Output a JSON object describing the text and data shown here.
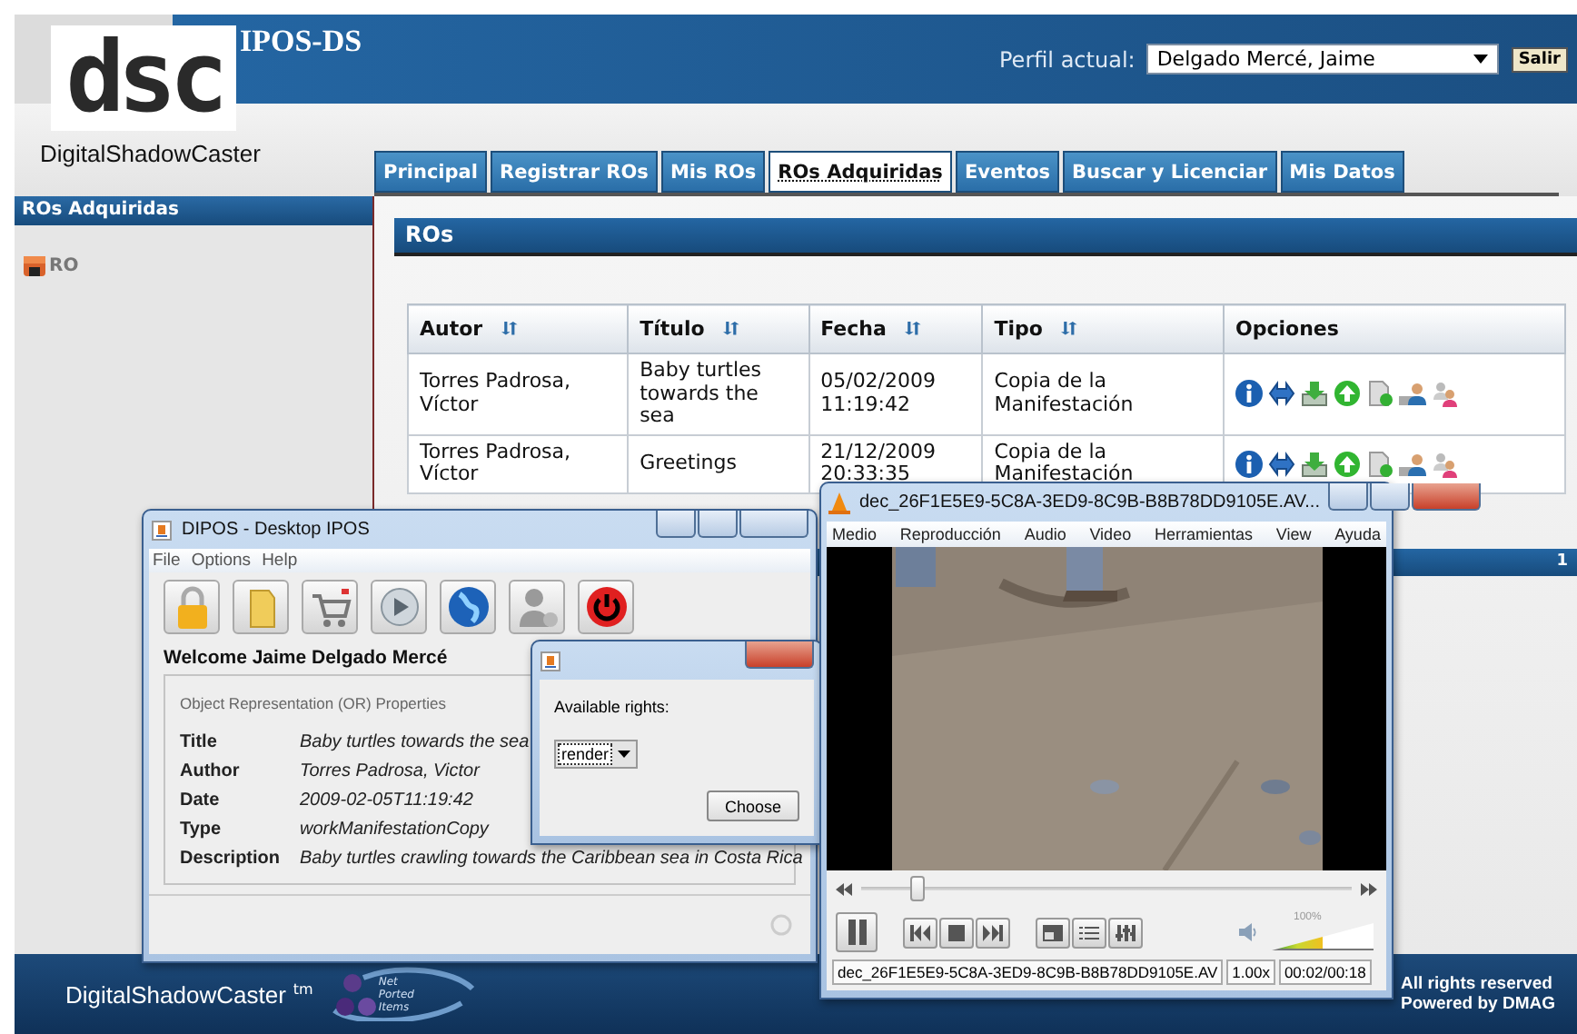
{
  "header": {
    "logo_mark": "dsc",
    "logo_text": "DigitalShadowCaster",
    "title": "IPOS-DS",
    "profile_label": "Perfil actual:",
    "profile_value": "Delgado Mercé, Jaime",
    "logout_button": "Salir"
  },
  "tabs": [
    {
      "label": "Principal",
      "selected": false
    },
    {
      "label": "Registrar ROs",
      "selected": false
    },
    {
      "label": "Mis ROs",
      "selected": false
    },
    {
      "label": "ROs Adquiridas",
      "selected": true
    },
    {
      "label": "Eventos",
      "selected": false
    },
    {
      "label": "Buscar y Licenciar",
      "selected": false
    },
    {
      "label": "Mis Datos",
      "selected": false
    }
  ],
  "sidebar": {
    "title": "ROs Adquiridas",
    "items": [
      {
        "label": "RO"
      }
    ]
  },
  "panel": {
    "title": "ROs",
    "pager": "1"
  },
  "table": {
    "columns": [
      {
        "label": "Autor",
        "sortable": true
      },
      {
        "label": "Título",
        "sortable": true
      },
      {
        "label": "Fecha",
        "sortable": true
      },
      {
        "label": "Tipo",
        "sortable": true
      },
      {
        "label": "Opciones",
        "sortable": false
      }
    ],
    "rows": [
      {
        "autor": "Torres Padrosa, Víctor",
        "titulo": "Baby turtles towards the sea",
        "fecha": "05/02/2009 11:19:42",
        "tipo": "Copia de la Manifestación"
      },
      {
        "autor": "Torres Padrosa, Víctor",
        "titulo": "Greetings",
        "fecha": "21/12/2009 20:33:35",
        "tipo": "Copia de la Manifestación"
      }
    ]
  },
  "footer": {
    "brand": "DigitalShadowCaster",
    "trademark": "tm",
    "partner_logo": [
      "Net",
      "Ported",
      "Items"
    ],
    "rights": "All rights reserved",
    "powered": "Powered by DMAG"
  },
  "dipos": {
    "title": "DIPOS - Desktop IPOS",
    "menu": [
      "File",
      "Options",
      "Help"
    ],
    "welcome": "Welcome Jaime Delgado Mercé",
    "group_title": "Object Representation (OR) Properties",
    "properties": [
      {
        "label": "Title",
        "value": "Baby turtles towards the sea"
      },
      {
        "label": "Author",
        "value": "Torres Padrosa, Victor"
      },
      {
        "label": "Date",
        "value": "2009-02-05T11:19:42"
      },
      {
        "label": "Type",
        "value": "workManifestationCopy"
      },
      {
        "label": "Description",
        "value": "Baby turtles crawling towards the Caribbean sea in Costa Rica"
      }
    ]
  },
  "dialog": {
    "label": "Available rights:",
    "value": "render",
    "button": "Choose"
  },
  "player": {
    "title": "dec_26F1E5E9-5C8A-3ED9-8C9B-B8B78DD9105E.AV...",
    "menu": [
      "Medio",
      "Reproducción",
      "Audio",
      "Video",
      "Herramientas",
      "View",
      "Ayuda"
    ],
    "seek": {
      "level": 0.11
    },
    "volume": {
      "label": "100%",
      "level": 0.5
    },
    "file": "dec_26F1E5E9-5C8A-3ED9-8C9B-B8B78DD9105E.AV",
    "speed": "1.00x",
    "time": "00:02/00:18"
  }
}
